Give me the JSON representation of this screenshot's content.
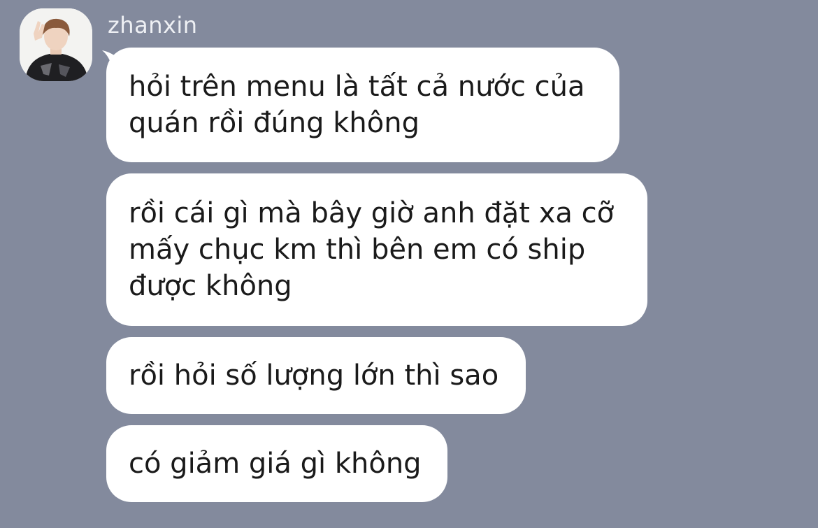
{
  "chat": {
    "sender_name": "zhanxin",
    "messages": [
      {
        "text": "hỏi trên menu là tất cả nước của\nquán rồi đúng không"
      },
      {
        "text": "rồi cái gì mà bây giờ anh đặt xa cỡ\nmấy chục km thì bên em có ship\nđược không"
      },
      {
        "text": "rồi hỏi số lượng lớn thì sao"
      },
      {
        "text": "có giảm giá gì không"
      }
    ]
  },
  "colors": {
    "background": "#838a9d",
    "bubble": "#ffffff",
    "text": "#1a1a1a",
    "name": "#eef0f4"
  },
  "icons": {
    "avatar": "user-photo-avatar"
  }
}
